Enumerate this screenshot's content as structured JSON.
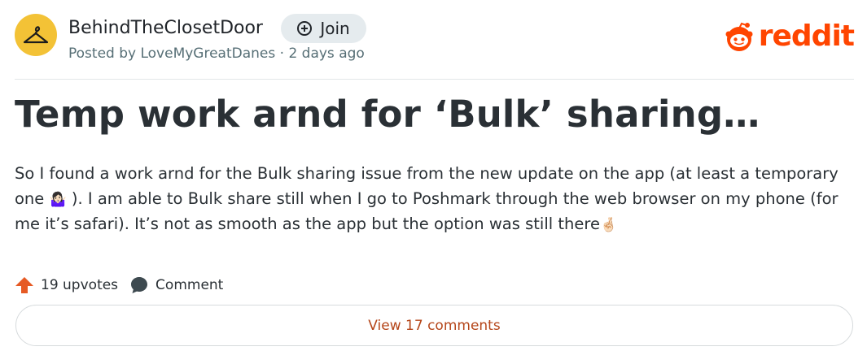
{
  "post": {
    "community": "BehindTheClosetDoor",
    "join_label": "Join",
    "posted_by": "Posted by LoveMyGreatDanes · 2 days ago",
    "title": "Temp work arnd for ‘Bulk’ sharing…",
    "body": {
      "part1": "So I found a work arnd for the Bulk sharing issue from the new update on the app (at least a temporary one",
      "emoji1": "🤷🏻‍♀️",
      "part2": "). I am able to Bulk share still when I go to Poshmark through the web browser on my phone (for me it’s safari). It’s not as smooth as the app but the option was still there",
      "emoji2": "🤞🏻"
    },
    "upvotes_label": "19 upvotes",
    "comment_label": "Comment",
    "view_comments_label": "View 17 comments"
  },
  "brand": {
    "wordmark": "reddit",
    "accent": "#ff4500"
  },
  "icons": {
    "avatar": "hanger-icon",
    "join": "plus-circle-icon",
    "upvote": "upvote-arrow-icon",
    "comment": "comment-bubble-icon",
    "logo": "reddit-alien-icon"
  },
  "colors": {
    "avatar_bg": "#f3c236",
    "join_bg": "#e5ebee",
    "upvote": "#e65a24",
    "view_comments_text": "#b5461a",
    "text": "#2a3035",
    "muted": "#576f76"
  }
}
